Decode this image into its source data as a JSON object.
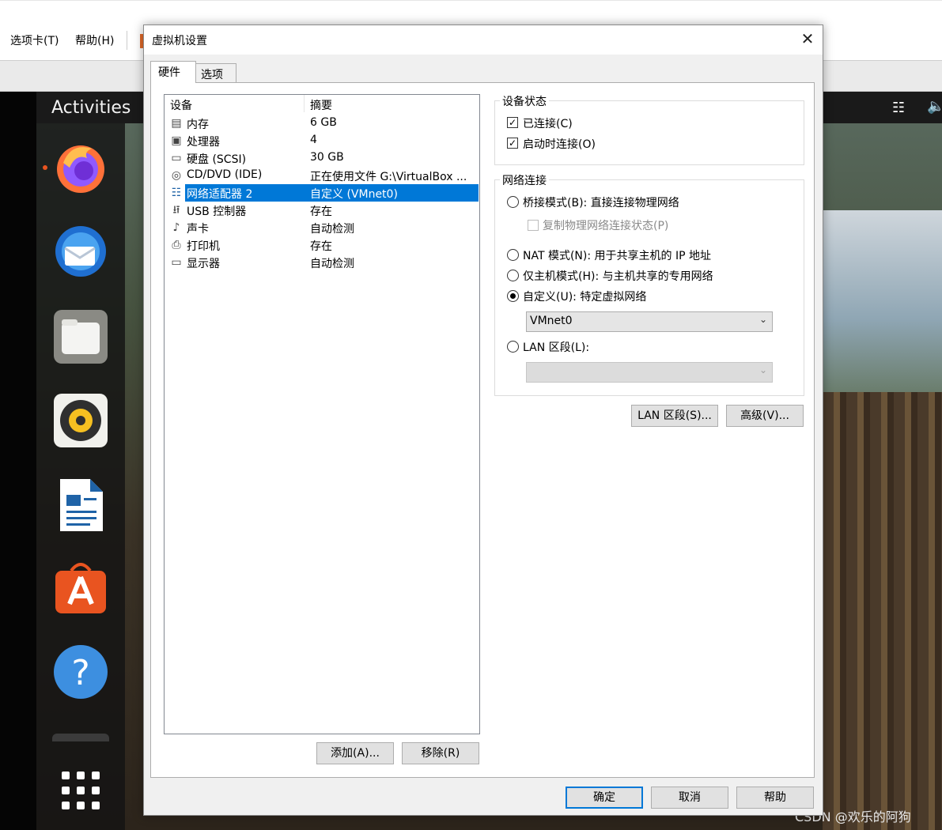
{
  "host": {
    "menu": [
      {
        "label": "选项卡(T)"
      },
      {
        "label": "帮助(H)"
      }
    ]
  },
  "guest": {
    "activities_label": "Activities",
    "dock_apps": [
      {
        "icon": "firefox-icon"
      },
      {
        "icon": "thunderbird-icon"
      },
      {
        "icon": "files-icon"
      },
      {
        "icon": "rhythmbox-icon"
      },
      {
        "icon": "libreoffice-writer-icon"
      },
      {
        "icon": "software-center-icon"
      },
      {
        "icon": "help-icon"
      }
    ],
    "watermark": "CSDN @欢乐的阿狗"
  },
  "dialog": {
    "title": "虚拟机设置",
    "tabs": [
      {
        "label": "硬件",
        "active": true
      },
      {
        "label": "选项",
        "active": false
      }
    ],
    "device_list": {
      "columns": [
        "设备",
        "摘要"
      ],
      "rows": [
        {
          "icon": "memory-icon",
          "name": "内存",
          "summary": "6 GB"
        },
        {
          "icon": "cpu-icon",
          "name": "处理器",
          "summary": "4"
        },
        {
          "icon": "hard-disk-icon",
          "name": "硬盘 (SCSI)",
          "summary": "30 GB"
        },
        {
          "icon": "cd-dvd-icon",
          "name": "CD/DVD (IDE)",
          "summary": "正在使用文件 G:\\VirtualBox ..."
        },
        {
          "icon": "network-adapter-icon",
          "name": "网络适配器 2",
          "summary": "自定义 (VMnet0)",
          "selected": true
        },
        {
          "icon": "usb-controller-icon",
          "name": "USB 控制器",
          "summary": "存在"
        },
        {
          "icon": "sound-card-icon",
          "name": "声卡",
          "summary": "自动检测"
        },
        {
          "icon": "printer-icon",
          "name": "打印机",
          "summary": "存在"
        },
        {
          "icon": "display-icon",
          "name": "显示器",
          "summary": "自动检测"
        }
      ]
    },
    "add_button": "添加(A)...",
    "remove_button": "移除(R)",
    "device_status": {
      "legend": "设备状态",
      "connected": {
        "label": "已连接(C)",
        "checked": true
      },
      "connect_at_power_on": {
        "label": "启动时连接(O)",
        "checked": true
      }
    },
    "network_connection": {
      "legend": "网络连接",
      "bridged": {
        "label": "桥接模式(B): 直接连接物理网络",
        "selected": false
      },
      "replicate": {
        "label": "复制物理网络连接状态(P)",
        "checked": false,
        "enabled": false
      },
      "nat": {
        "label": "NAT 模式(N): 用于共享主机的 IP 地址",
        "selected": false
      },
      "host_only": {
        "label": "仅主机模式(H): 与主机共享的专用网络",
        "selected": false
      },
      "custom": {
        "label": "自定义(U): 特定虚拟网络",
        "selected": true
      },
      "custom_select_value": "VMnet0",
      "lan_segment": {
        "label": "LAN 区段(L):",
        "selected": false
      },
      "lan_select_value": ""
    },
    "lan_segments_button": "LAN 区段(S)...",
    "advanced_button": "高级(V)...",
    "ok_button": "确定",
    "cancel_button": "取消",
    "help_button": "帮助"
  }
}
